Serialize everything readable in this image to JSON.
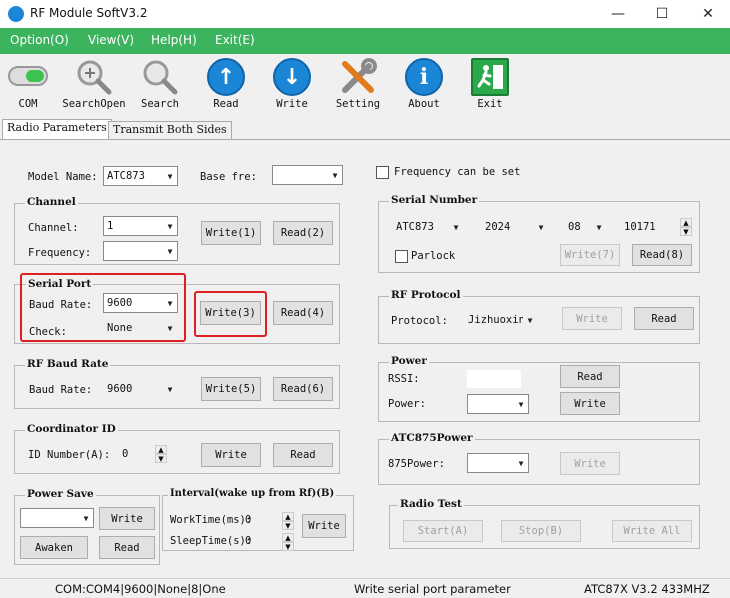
{
  "window": {
    "title": "RF Module SoftV3.2",
    "min": "—",
    "max": "☐",
    "close": "✕"
  },
  "menu": [
    "Option(O)",
    "View(V)",
    "Help(H)",
    "Exit(E)"
  ],
  "toolbar": {
    "com": "COM",
    "searchopen": "SearchOpen",
    "search": "Search",
    "read": "Read",
    "write": "Write",
    "setting": "Setting",
    "about": "About",
    "exit": "Exit",
    "about_glyph": "i",
    "read_glyph": "↑",
    "write_glyph": "↓"
  },
  "tabs": {
    "radio": "Radio Parameters",
    "transmit": "Transmit Both Sides"
  },
  "top": {
    "model_label": "Model Name:",
    "model_value": "ATC873",
    "basefre_label": "Base fre:",
    "basefre_value": "",
    "freq_set_label": "Frequency can be set"
  },
  "channel": {
    "title": "Channel",
    "channel_label": "Channel:",
    "channel_value": "1",
    "freq_label": "Frequency:",
    "freq_value": "",
    "write": "Write(1)",
    "read": "Read(2)"
  },
  "serial_port": {
    "title": "Serial Port",
    "baud_label": "Baud Rate:",
    "baud_value": "9600",
    "check_label": "Check:",
    "check_value": "None",
    "write": "Write(3)",
    "read": "Read(4)"
  },
  "rf_baud": {
    "title": "RF Baud Rate",
    "baud_label": "Baud Rate:",
    "baud_value": "9600",
    "write": "Write(5)",
    "read": "Read(6)"
  },
  "coordinator": {
    "title": "Coordinator ID",
    "id_label": "ID Number(A):",
    "id_value": "0",
    "write": "Write",
    "read": "Read"
  },
  "power_save": {
    "title": "Power Save",
    "value": "",
    "write": "Write",
    "awaken": "Awaken",
    "read": "Read"
  },
  "interval": {
    "title": "Interval(wake up from Rf)(B)",
    "work_label": "WorkTime(ms):",
    "work_value": "0",
    "sleep_label": "SleepTime(s):",
    "sleep_value": "0",
    "write": "Write"
  },
  "serial_number": {
    "title": "Serial Number",
    "model": "ATC873",
    "year": "2024",
    "month": "08",
    "number": "10171",
    "parlock": "Parlock",
    "write": "Write(7)",
    "read": "Read(8)"
  },
  "rf_protocol": {
    "title": "RF Protocol",
    "protocol_label": "Protocol:",
    "protocol_value": "Jizhuoxin",
    "write": "Write",
    "read": "Read"
  },
  "power": {
    "title": "Power",
    "rssi_label": "RSSI:",
    "rssi_value": "",
    "power_label": "Power:",
    "power_value": "",
    "read": "Read",
    "write": "Write"
  },
  "atc875": {
    "title": "ATC875Power",
    "power_label": "875Power:",
    "power_value": "",
    "write": "Write"
  },
  "radio_test": {
    "title": "Radio Test",
    "start": "Start(A)",
    "stop": "Stop(B)",
    "write_all": "Write All"
  },
  "status": {
    "left": "COM:COM4|9600|None|8|One",
    "middle": "Write serial port parameter",
    "right": "ATC87X V3.2 433MHZ"
  },
  "colors": {
    "menu_green": "#3cb45e",
    "highlight_red": "#e02020",
    "icon_blue": "#1c86d6"
  }
}
